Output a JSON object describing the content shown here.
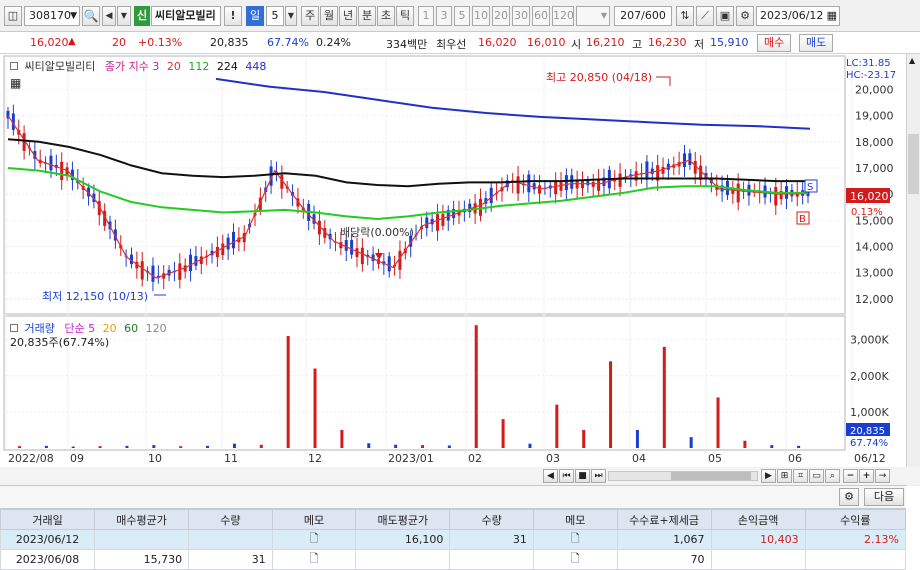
{
  "toolbar": {
    "code": "308170",
    "credit_badge": "신",
    "stock_name": "씨티알모빌리",
    "alert_btn": "!",
    "periods": [
      "일",
      "5",
      "주",
      "월",
      "년",
      "분",
      "초",
      "틱"
    ],
    "minute_opts": [
      "1",
      "3",
      "5",
      "10",
      "20",
      "30",
      "60",
      "120"
    ],
    "range": "207/600",
    "date": "2023/06/12"
  },
  "quote": {
    "price": "16,020",
    "change": "20",
    "change_rate": "+0.13%",
    "volume": "20,835",
    "volume_ratio": "67.74%",
    "turnover": "0.24%",
    "amount": "334백만",
    "best_label": "최우선",
    "best_ask": "16,020",
    "best_bid": "16,010",
    "open_label": "시",
    "open": "16,210",
    "high_label": "고",
    "high": "16,230",
    "low_label": "저",
    "low": "15,910",
    "buy_btn": "매수",
    "sell_btn": "매도"
  },
  "legend": {
    "name": "씨티알모빌리티",
    "ma_label": "종가 지수 3",
    "ma_periods": [
      "20",
      "112",
      "224",
      "448"
    ],
    "vol_title": "거래량",
    "vol_ma_label": "단순 5",
    "vol_ma_periods": [
      "20",
      "60",
      "120"
    ],
    "vol_info": "20,835주(67.74%)"
  },
  "annotations": {
    "high": "최고 20,850 (04/18)",
    "low": "최저 12,150 (10/13)",
    "div": "배당락(0.00%)",
    "lc": "LC:31.85",
    "hc": "HC:-23.17",
    "price_tag": "16,020",
    "pct_tag": "0.13%",
    "vol_tag": "20,835",
    "vol_pct_tag": "67.74%",
    "sell_marker": "S",
    "buy_marker": "B"
  },
  "colors": {
    "up": "#d41b1b",
    "down": "#1a3fd0",
    "ma20": "#e03030",
    "ma112": "#22cc22",
    "ma224": "#111111",
    "ma448": "#2030c8",
    "vol_ma5": "#cc22cc",
    "vol_ma20": "#e8a000",
    "vol_ma60": "#1e7b1e",
    "vol_ma120": "#999999"
  },
  "x_axis": [
    "2022/08",
    "09",
    "10",
    "11",
    "12",
    "2023/01",
    "02",
    "03",
    "04",
    "05",
    "06",
    "06/12"
  ],
  "chart_data": {
    "type": "line",
    "title": "",
    "ylim": [
      11500,
      21200
    ],
    "yticks": [
      12000,
      13000,
      14000,
      15000,
      16000,
      17000,
      18000,
      19000,
      20000
    ],
    "ytick_labels": [
      "12,000",
      "13,000",
      "14,000",
      "15,000",
      "16,000",
      "17,000",
      "18,000",
      "19,000",
      "20,000"
    ],
    "series": [
      {
        "name": "종가",
        "values": [
          19000,
          17300,
          16900,
          15700,
          13600,
          12800,
          13200,
          13800,
          14400,
          16900,
          15400,
          14200,
          13700,
          13200,
          14800,
          15200,
          15600,
          16500,
          16200,
          16400,
          16400,
          16700,
          16900,
          17300,
          16200,
          16100,
          16000,
          16020
        ]
      },
      {
        "name": "MA112",
        "values": [
          17000,
          16900,
          16700,
          16100,
          15700,
          15500,
          15400,
          15300,
          15350,
          15400,
          15300,
          15150,
          15050,
          15150,
          15300,
          15400,
          15550,
          15650,
          15750,
          15900,
          16050,
          16250,
          16300,
          16300,
          16150,
          16050,
          16050
        ]
      },
      {
        "name": "MA224",
        "values": [
          18100,
          18000,
          17800,
          17500,
          17100,
          16800,
          16700,
          16650,
          16700,
          16800,
          16700,
          16450,
          16350,
          16300,
          16400,
          16450,
          16450,
          16500,
          16500,
          16550,
          16600,
          16600,
          16600,
          16600,
          16550,
          16500,
          16500
        ]
      },
      {
        "name": "MA448",
        "values": [
          20400,
          20100,
          19900,
          19600,
          19300,
          19100,
          18950,
          18850,
          18750,
          18650,
          18600,
          18500
        ]
      }
    ],
    "volume": {
      "ylim": [
        0,
        3600000
      ],
      "yticks": [
        1000000,
        2000000,
        3000000
      ],
      "ytick_labels": [
        "1,000K",
        "2,000K",
        "3,000K"
      ],
      "values": [
        50000,
        60000,
        40000,
        50000,
        60000,
        80000,
        50000,
        60000,
        120000,
        90000,
        3100000,
        2200000,
        500000,
        130000,
        90000,
        80000,
        70000,
        3400000,
        800000,
        120000,
        1200000,
        500000,
        2400000,
        500000,
        2800000,
        300000,
        1400000,
        200000,
        80000,
        60000
      ]
    }
  },
  "table": {
    "headers": [
      "거래일",
      "매수평균가",
      "수량",
      "메모",
      "매도평균가",
      "수량",
      "메모",
      "수수료+제세금",
      "손익금액",
      "수익률"
    ],
    "rows": [
      [
        "2023/06/12",
        "",
        "",
        "",
        "16,100",
        "31",
        "",
        "1,067",
        "10,403",
        "2.13%"
      ],
      [
        "2023/06/08",
        "15,730",
        "31",
        "",
        "",
        "",
        "",
        "70",
        "",
        ""
      ]
    ]
  },
  "buttons": {
    "next": "다음"
  }
}
